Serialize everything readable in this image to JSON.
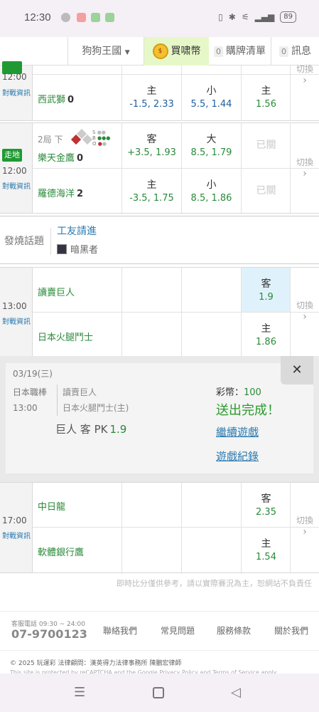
{
  "status": {
    "time": "12:30",
    "battery": "89"
  },
  "nav": {
    "kingdom": "狗狗王國",
    "coin": "買啸幣",
    "list_count": "0",
    "list": "購牌清單",
    "msg_count": "0",
    "msg": "訊息"
  },
  "matches": [
    {
      "time": "12:00",
      "info": "對戰資訊",
      "team_top": "",
      "team_bottom": "西武獅",
      "score_bottom": "0",
      "odds_bottom": [
        {
          "label": "主",
          "value": "-1.5, 2.33"
        },
        {
          "label": "小",
          "value": "5.5, 1.44"
        },
        {
          "label": "主",
          "value": "1.56"
        }
      ],
      "switch": "切換"
    },
    {
      "status": "走地",
      "time": "12:00",
      "info": "對戰資訊",
      "inning": "2局 下",
      "bso": {
        "b": "B",
        "s": "S",
        "o": "O"
      },
      "team_top": "樂天金鷹",
      "score_top": "0",
      "team_bottom": "羅德海洋",
      "score_bottom": "2",
      "odds_top": [
        {
          "label": "客",
          "value": "+3.5, 1.93"
        },
        {
          "label": "大",
          "value": "8.5, 1.79"
        }
      ],
      "odds_bottom": [
        {
          "label": "主",
          "value": "-3.5, 1.75"
        },
        {
          "label": "小",
          "value": "8.5, 1.86"
        }
      ],
      "closed": "已關",
      "switch": "切換"
    },
    {
      "time": "13:00",
      "info": "對戰資訊",
      "team_top": "讀賣巨人",
      "team_bottom": "日本火腿鬥士",
      "ml_top": {
        "label": "客",
        "value": "1.9"
      },
      "ml_bottom": {
        "label": "主",
        "value": "1.86"
      },
      "switch": "切換"
    },
    {
      "time": "17:00",
      "info": "對戰資訊",
      "team_top": "中日龍",
      "team_bottom": "軟體銀行鷹",
      "ml_top": {
        "label": "客",
        "value": "2.35"
      },
      "ml_bottom": {
        "label": "主",
        "value": "1.54"
      },
      "switch": "切換"
    }
  ],
  "hot": {
    "label": "發燒話題",
    "title": "工友請進",
    "author": "暗黑者"
  },
  "overlay": {
    "close": "✕",
    "date": "03/19(三)",
    "league": "日本職棒",
    "time": "13:00",
    "team1": "讀賣巨人",
    "team2": "日本火腿鬥士(主)",
    "pick_team": "巨人",
    "pick_type": "客 PK",
    "pick_value": "1.9",
    "coin_label": "彩幣：",
    "coin_value": "100",
    "done": "送出完成！",
    "continue": "繼續遊戲",
    "record": "遊戲紀錄"
  },
  "disclaimer": "即時比分僅供參考，請以實際賽況為主，恕網站不負責任",
  "footer": {
    "cs_label": "客服電話 09:30 ~ 24:00",
    "cs_phone": "07-9700123",
    "links": [
      "聯絡我們",
      "常見問題",
      "服務條款",
      "關於我們"
    ],
    "copyright": "© 2025 玩運彩 法律顧問：漢英得力法律事務所 陳鵬宏律師",
    "captcha": "This site is protected by reCAPTCHA and the Google Privacy Policy and Terms of Service apply."
  },
  "colors": {
    "green": "#2a8a3a",
    "link": "#2a7ab0",
    "walk": "#1f9a32",
    "selected": "#dff2fb"
  }
}
